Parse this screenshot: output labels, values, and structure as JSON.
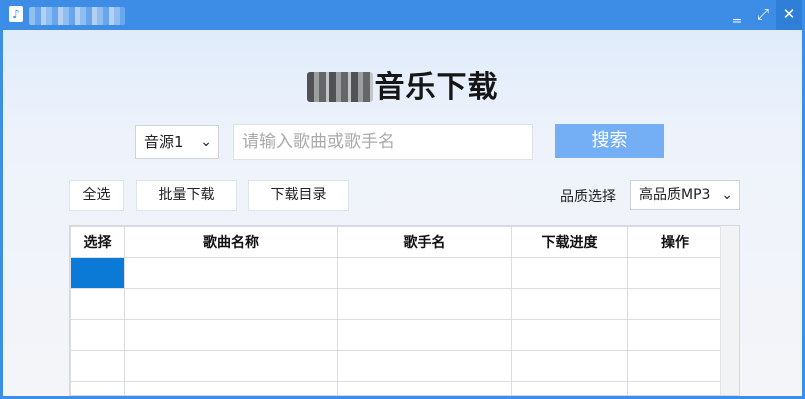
{
  "window": {
    "controls": {
      "minimize": "‗",
      "maximize": "⤢",
      "close": "✕"
    }
  },
  "heading": {
    "title_visible": "音乐下载"
  },
  "search": {
    "source_value": "音源1",
    "placeholder": "请输入歌曲或歌手名",
    "button_label": "搜索"
  },
  "toolbar": {
    "select_all": "全选",
    "batch_download": "批量下载",
    "download_dir": "下载目录",
    "quality_label": "品质选择",
    "quality_value": "高品质MP3"
  },
  "table": {
    "headers": [
      "选择",
      "歌曲名称",
      "歌手名",
      "下载进度",
      "操作"
    ],
    "selected_row": 0
  },
  "colors": {
    "titlebar": "#3d8de6",
    "search_button": "#74aff6",
    "selected_cell": "#0a7ad6"
  }
}
